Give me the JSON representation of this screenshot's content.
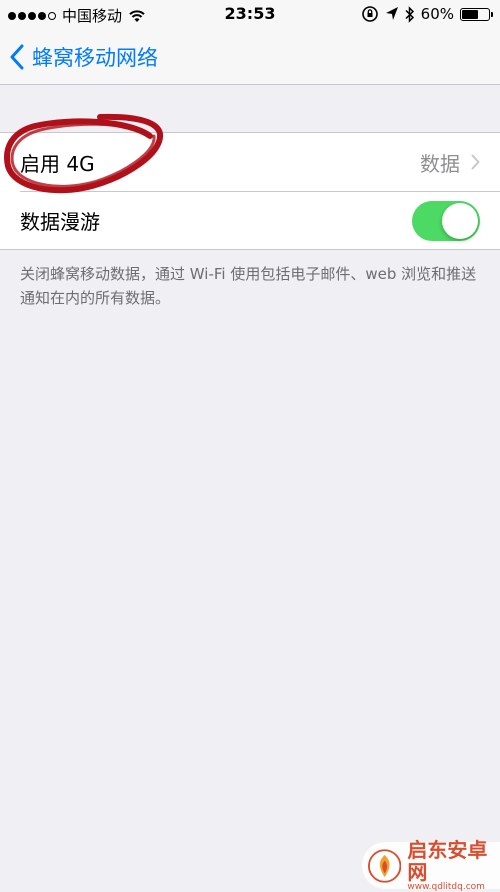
{
  "status_bar": {
    "carrier": "中国移动",
    "time": "23:53",
    "battery_percent": "60%",
    "battery_level": 0.6,
    "signal_bars": 4,
    "icons": [
      "wifi-icon",
      "orientation-lock-icon",
      "location-icon",
      "bluetooth-icon",
      "battery-icon"
    ]
  },
  "nav": {
    "back_label": "蜂窝移动网络"
  },
  "settings": {
    "enable_4g": {
      "label": "启用 4G",
      "value": "数据"
    },
    "data_roaming": {
      "label": "数据漫游",
      "on": true
    }
  },
  "footnote": "关闭蜂窝移动数据，通过 Wi-Fi 使用包括电子邮件、web 浏览和推送通知在内的所有数据。",
  "watermark": {
    "name": "启东安卓网",
    "url": "www.qdlitdq.com"
  },
  "colors": {
    "accent": "#007aff",
    "toggle_on": "#4cd964",
    "annotation": "#b0101a",
    "background": "#efeff4"
  }
}
